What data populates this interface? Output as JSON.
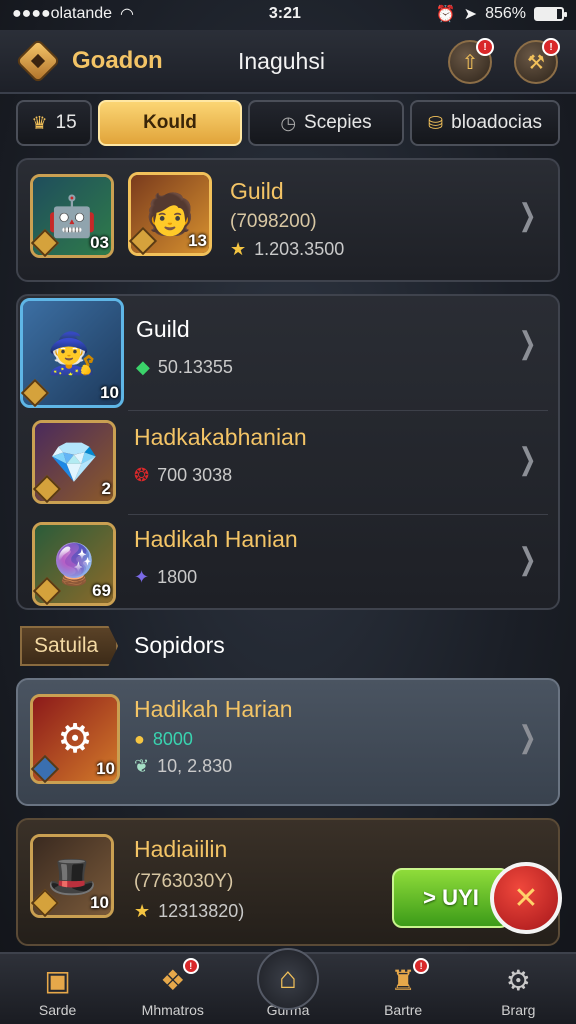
{
  "status_bar": {
    "carrier": "●●●●olatande",
    "time": "3:21",
    "battery_percent": "856%"
  },
  "header": {
    "app_name": "Goadon",
    "title": "Inaguhsi",
    "left_button_icon": "arrow-up-icon",
    "right_button_icon": "tools-icon"
  },
  "tabs": [
    {
      "label": "15",
      "icon": "crown-icon",
      "active": false
    },
    {
      "label": "Kould",
      "icon": "",
      "active": true
    },
    {
      "label": "Scepies",
      "icon": "clock-icon",
      "active": false
    },
    {
      "label": "bloadocias",
      "icon": "coins-icon",
      "active": false
    }
  ],
  "card_guild": {
    "portrait1_level": "03",
    "portrait2_level": "13",
    "title": "Guild",
    "subtitle": "(7098200)",
    "value": "1.203.3500"
  },
  "list_rows": [
    {
      "title": "Guild",
      "value": "50.13355",
      "level": "10",
      "icon": "gem-icon"
    },
    {
      "title": "Hadkakabhanian",
      "value": "700 3038",
      "level": "2",
      "icon": "ruby-icon"
    },
    {
      "title": "Hadikah Hanian",
      "value": "1800",
      "level": "69",
      "icon": "crystal-icon"
    }
  ],
  "section": {
    "tag": "Satuila",
    "title": "Sopidors"
  },
  "highlight_row": {
    "title": "Hadikah Harian",
    "gold_value": "8000",
    "value": "10, 2.830",
    "level": "10"
  },
  "last_row": {
    "title": "Hadiaiilin",
    "subtitle": "(7763030Y)",
    "value": "12313820)",
    "level": "10",
    "buy_label": "> UYI"
  },
  "bottom_nav": [
    {
      "label": "Sarde",
      "icon": "chest-icon",
      "badge": ""
    },
    {
      "label": "Mhmatros",
      "icon": "scroll-icon",
      "badge": "!"
    },
    {
      "label": "Gurma",
      "icon": "home-icon",
      "badge": ""
    },
    {
      "label": "Bartre",
      "icon": "castle-icon",
      "badge": "!"
    },
    {
      "label": "Brarg",
      "icon": "gear-icon",
      "badge": ""
    }
  ]
}
